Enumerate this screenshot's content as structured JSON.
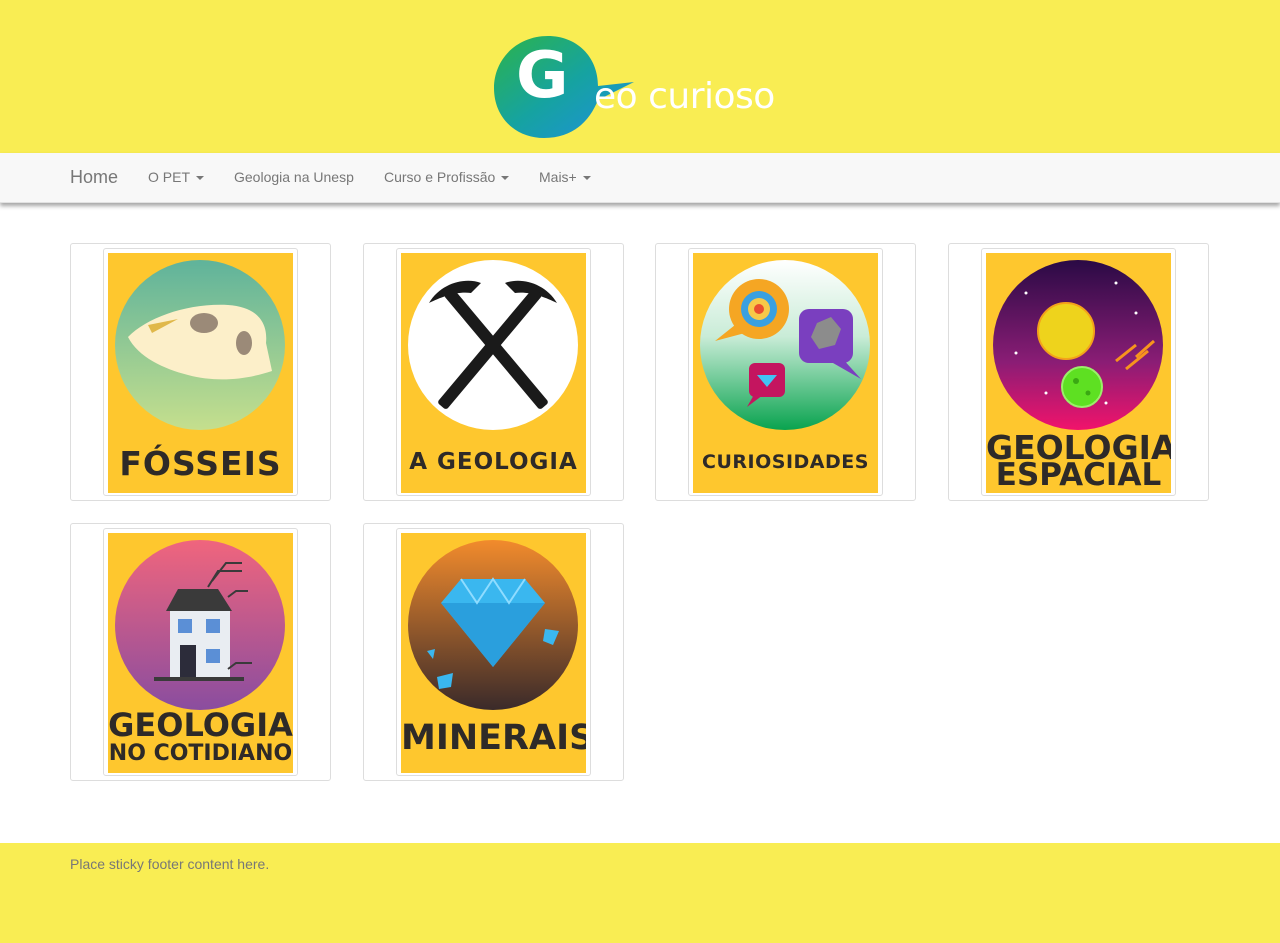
{
  "brand": {
    "logo_letter": "G",
    "logo_text": "eo curioso",
    "colors": {
      "green": "#2cb34a",
      "blue": "#1e8fe0",
      "header_bg": "#f9ed53"
    }
  },
  "nav": {
    "home": "Home",
    "items": [
      {
        "label": "O PET",
        "dropdown": true
      },
      {
        "label": "Geologia na Unesp",
        "dropdown": false
      },
      {
        "label": "Curso e Profissão",
        "dropdown": true
      },
      {
        "label": "Mais+",
        "dropdown": true
      }
    ]
  },
  "cards": [
    {
      "line1": "FÓSSEIS",
      "line2": ""
    },
    {
      "line1": "A GEOLOGIA",
      "line2": ""
    },
    {
      "line1": "CURIOSIDADES",
      "line2": ""
    },
    {
      "line1": "GEOLOGIA",
      "line2": "ESPACIAL"
    },
    {
      "line1": "GEOLOGIA",
      "line2": "NO COTIDIANO"
    },
    {
      "line1": "MINERAIS",
      "line2": ""
    }
  ],
  "poster_bg": "#fec72e",
  "footer": {
    "text": "Place sticky footer content here."
  }
}
